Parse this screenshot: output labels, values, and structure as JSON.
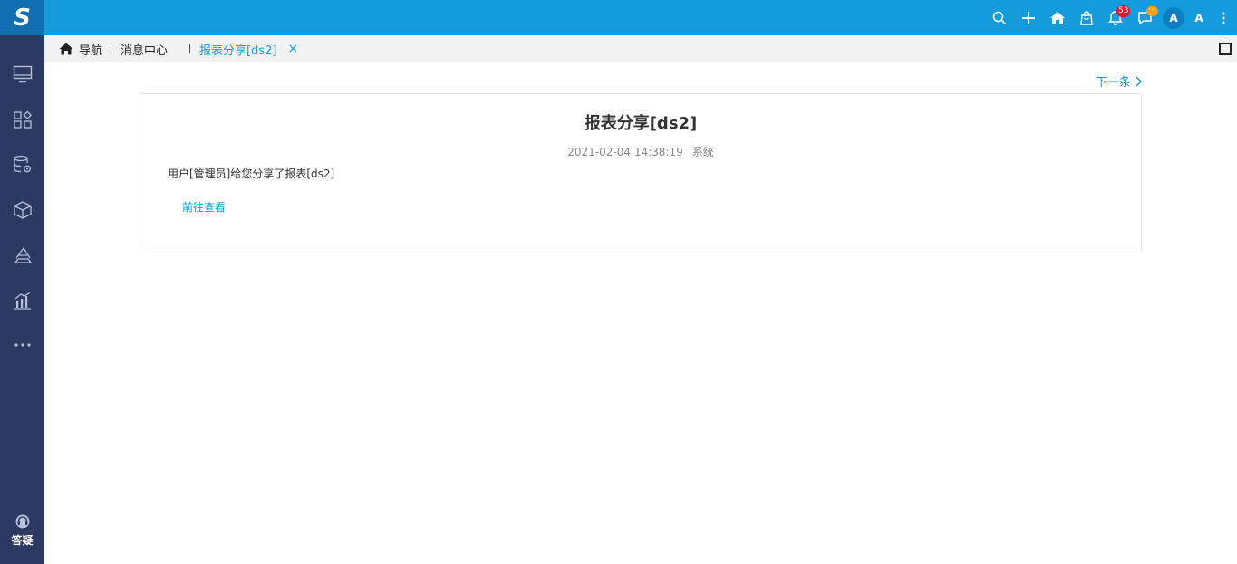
{
  "app": {
    "logo_letter": "S",
    "colors": {
      "topbar": "#139bdb",
      "sidebar": "#2c3a63",
      "accent": "#139bdb",
      "badge": "#e8112d",
      "chat_badge": "#f0a01c"
    }
  },
  "topbar": {
    "icons": [
      "search-icon",
      "plus-icon",
      "home-icon",
      "bag-icon",
      "bell-icon",
      "chat-icon",
      "more-vertical-icon"
    ],
    "notification_count": "53",
    "chat_badge": "···",
    "avatar_initial": "A",
    "user_name": "A"
  },
  "sidebar": {
    "items": [
      "monitor-icon",
      "apps-icon",
      "database-gear-icon",
      "cube-icon",
      "layers-icon",
      "chart-icon",
      "more-icon"
    ],
    "help_label": "答疑"
  },
  "tabs": {
    "nav_label": "导航",
    "message_center_label": "消息中心",
    "active_tab_label": "报表分享[ds2]",
    "close_symbol": "×"
  },
  "message": {
    "next_label": "下一条",
    "title": "报表分享[ds2]",
    "datetime": "2021-02-04 14:38:19",
    "sender": "系统",
    "body": "用户[管理员]给您分享了报表[ds2]",
    "link_label": "前往查看"
  }
}
